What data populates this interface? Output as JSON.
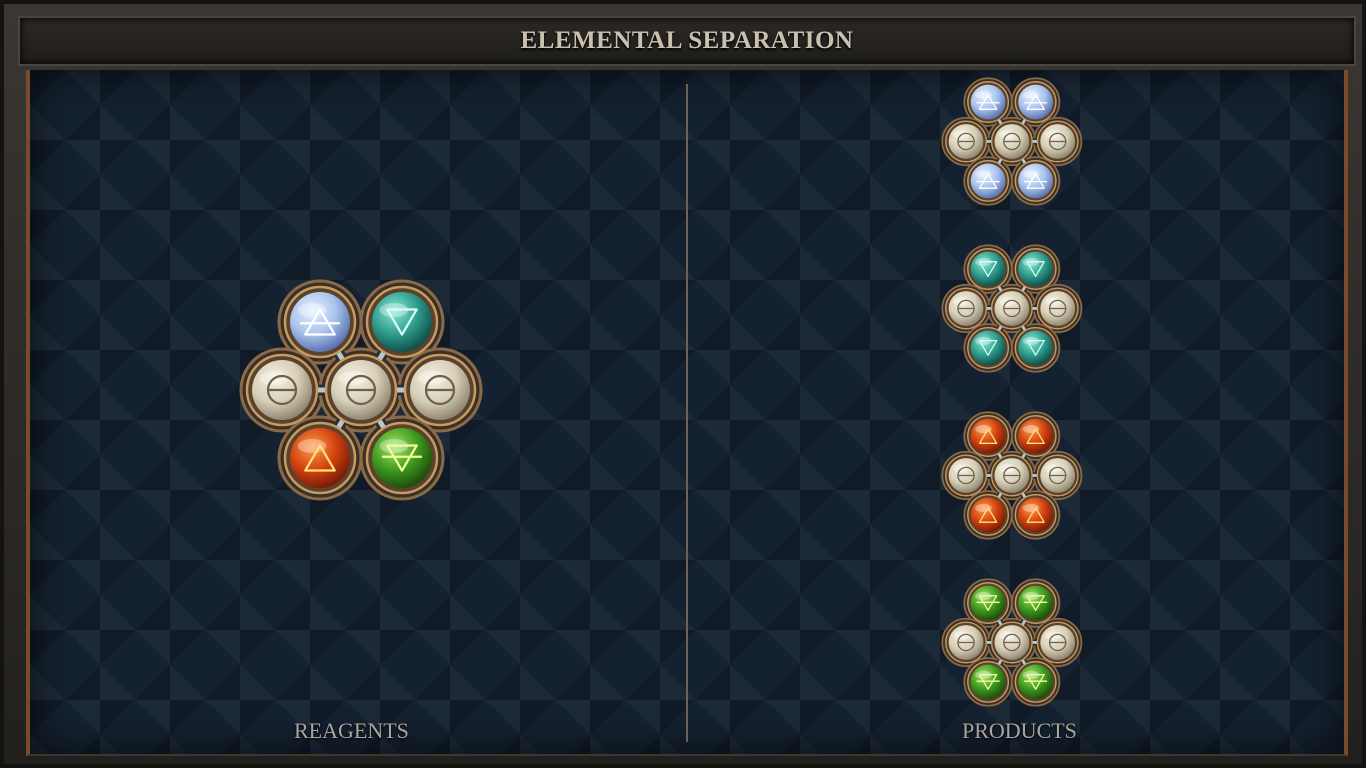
{
  "title": "ELEMENTAL SEPARATION",
  "labels": {
    "reagents": "REAGENTS",
    "products": "PRODUCTS"
  },
  "elements": {
    "air": {
      "glyph": "air-symbol",
      "base": "#a9c4ec",
      "light": "#e6f1ff",
      "dark": "#5b72b0",
      "line": "#ffffff"
    },
    "water": {
      "glyph": "water-symbol",
      "base": "#2f9c8c",
      "light": "#8ae8d7",
      "dark": "#0f4f4a",
      "line": "#d7fff5"
    },
    "fire": {
      "glyph": "fire-symbol",
      "base": "#d2430f",
      "light": "#ff9a4c",
      "dark": "#7a1a06",
      "line": "#ffe27a"
    },
    "earth": {
      "glyph": "earth-symbol",
      "base": "#3f9a1f",
      "light": "#a7e56a",
      "dark": "#1d4d0b",
      "line": "#f2ff9a"
    },
    "salt": {
      "glyph": "salt-symbol",
      "base": "#d8d0b8",
      "light": "#f4efe0",
      "dark": "#8f8672",
      "line": "#6b624f"
    }
  },
  "reagent": {
    "name": "reagent-molecule",
    "atoms": [
      "air",
      "water",
      "salt",
      "salt",
      "salt",
      "fire",
      "earth"
    ]
  },
  "products": [
    {
      "name": "product-air-molecule",
      "atoms": [
        "air",
        "air",
        "salt",
        "salt",
        "salt",
        "air",
        "air"
      ]
    },
    {
      "name": "product-water-molecule",
      "atoms": [
        "water",
        "water",
        "salt",
        "salt",
        "salt",
        "water",
        "water"
      ]
    },
    {
      "name": "product-fire-molecule",
      "atoms": [
        "fire",
        "fire",
        "salt",
        "salt",
        "salt",
        "fire",
        "fire"
      ]
    },
    {
      "name": "product-earth-molecule",
      "atoms": [
        "earth",
        "earth",
        "salt",
        "salt",
        "salt",
        "earth",
        "earth"
      ]
    }
  ]
}
